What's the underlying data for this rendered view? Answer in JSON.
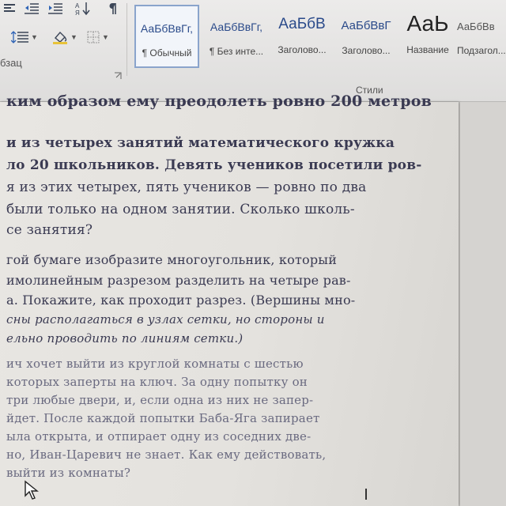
{
  "ribbon": {
    "paragraph_group_label": "бзац",
    "styles_group_label": "Стили",
    "styles": [
      {
        "sample": "АаБбВвГг,",
        "name": "¶ Обычный",
        "selected": true
      },
      {
        "sample": "АаБбВвГг,",
        "name": "¶ Без инте..."
      },
      {
        "sample": "АаБбВ",
        "name": "Заголово..."
      },
      {
        "sample": "АаБбВвГ",
        "name": "Заголово..."
      },
      {
        "sample": "АаЬ",
        "name": "Название"
      },
      {
        "sample": "АаБбВв",
        "name": "Подзагол..."
      }
    ]
  },
  "document": {
    "lines": [
      {
        "text": "ким образом ему преодолеть ровно 200 метров",
        "style": "bold"
      },
      {
        "text": "и из четырех занятий математического кружка",
        "style": "bold"
      },
      {
        "text": "ло 20 школьников. Девять учеников посетили ров-",
        "style": "bold"
      },
      {
        "text": "я из этих четырех, пять учеников — ровно по два",
        "style": "normal"
      },
      {
        "text": "были только на одном занятии. Сколько школь-",
        "style": "normal"
      },
      {
        "text": "се занятия?",
        "style": "normal"
      },
      {
        "text": "гой бумаге изобразите многоугольник, который",
        "style": "normal"
      },
      {
        "text": "имолинейным разрезом разделить на четыре рав-",
        "style": "normal"
      },
      {
        "text": "а. Покажите, как проходит разрез. (Вершины мно-",
        "style": "mixed"
      },
      {
        "text": "сны располагаться в узлах сетки, но стороны и",
        "style": "em"
      },
      {
        "text": "ельно проводить по линиям сетки.)",
        "style": "em"
      },
      {
        "text": "ич хочет выйти из круглой комнаты с шестью",
        "style": "faint"
      },
      {
        "text": "которых заперты на ключ. За одну попытку он",
        "style": "faint"
      },
      {
        "text": "три любые двери, и, если одна из них не запер-",
        "style": "faint"
      },
      {
        "text": "йдет. После каждой попытки Баба-Яга запирает",
        "style": "faint"
      },
      {
        "text": "ыла открыта, и отпирает одну из соседних две-",
        "style": "faint"
      },
      {
        "text": "но, Иван-Царевич не знает. Как ему действовать,",
        "style": "faint"
      },
      {
        "text": "выйти из комнаты?",
        "style": "faint"
      }
    ]
  },
  "icons": [
    "align-left-icon",
    "indent-decrease-icon",
    "indent-increase-icon",
    "sort-icon",
    "pilcrow-icon",
    "line-spacing-icon",
    "shading-icon",
    "borders-icon",
    "mouse-cursor-icon"
  ],
  "colors": {
    "text": "#3a3a52",
    "style_sample": "#2a4a8a",
    "selected_border": "#8aa4cc"
  }
}
